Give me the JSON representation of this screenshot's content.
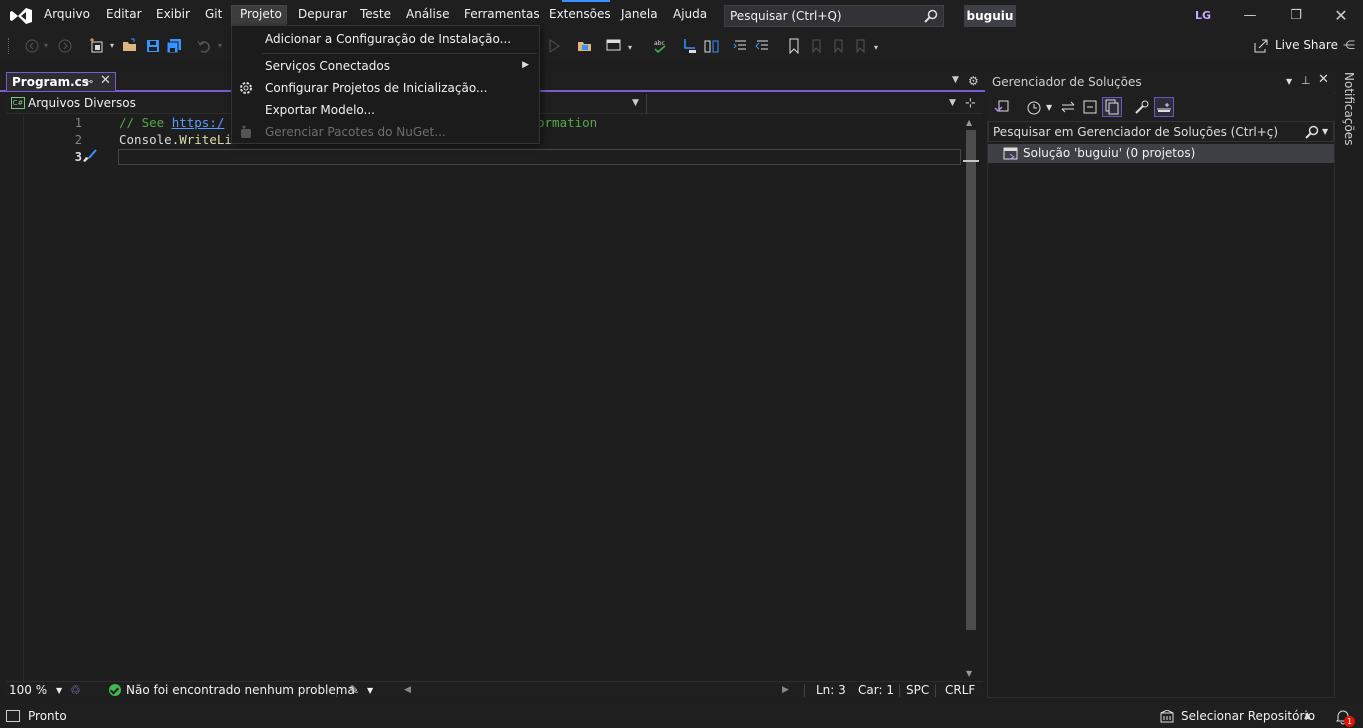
{
  "menu": {
    "items": [
      "Arquivo",
      "Editar",
      "Exibir",
      "Git",
      "Projeto",
      "Depurar",
      "Teste",
      "Análise",
      "Ferramentas",
      "Extensões",
      "Janela",
      "Ajuda"
    ],
    "active": "Projeto"
  },
  "search": {
    "placeholder": "Pesquisar (Ctrl+Q)"
  },
  "solution_name": "buguiu",
  "user_initials": "LG",
  "toolbar": {
    "live_share_label": "Live Share"
  },
  "editor": {
    "tab_label": "Program.cs",
    "project_combo": "Arquivos Diversos",
    "line_numbers": [
      "1",
      "2",
      "3"
    ],
    "code": {
      "line1_prefix": "// See ",
      "line1_link": "https:/",
      "line1_suffix": "ormation",
      "line2_ident": "Console",
      "line2_dot": ".",
      "line2_method": "WriteLi"
    },
    "zoom": "100 %",
    "issues": "Não foi encontrado nenhum problema",
    "ln": "Ln: 3",
    "car": "Car: 1",
    "spc": "SPC",
    "crlf": "CRLF"
  },
  "project_menu": {
    "items": [
      {
        "label": "Adicionar a Configuração de Instalação...",
        "enabled": true
      },
      {
        "label": "Serviços Conectados",
        "enabled": true,
        "submenu": true
      },
      {
        "label": "Configurar Projetos de Inicialização...",
        "enabled": true,
        "icon": "gear-icon"
      },
      {
        "label": "Exportar Modelo...",
        "enabled": true
      },
      {
        "label": "Gerenciar Pacotes do NuGet...",
        "enabled": false,
        "icon": "nuget-icon"
      }
    ]
  },
  "solution_explorer": {
    "title": "Gerenciador de Soluções",
    "search_label": "Pesquisar em Gerenciador de Soluções (Ctrl+ç)",
    "solution_row": "Solução 'buguiu' (0 projetos)"
  },
  "notifications_label": "Notificações",
  "statusbar": {
    "ready": "Pronto",
    "repo": "Selecionar Repositório",
    "notification_count": "1"
  },
  "colors": {
    "accent": "#7b5ccf",
    "background": "#1e1e1e",
    "comment": "#57a64a",
    "link": "#5d9bff"
  }
}
